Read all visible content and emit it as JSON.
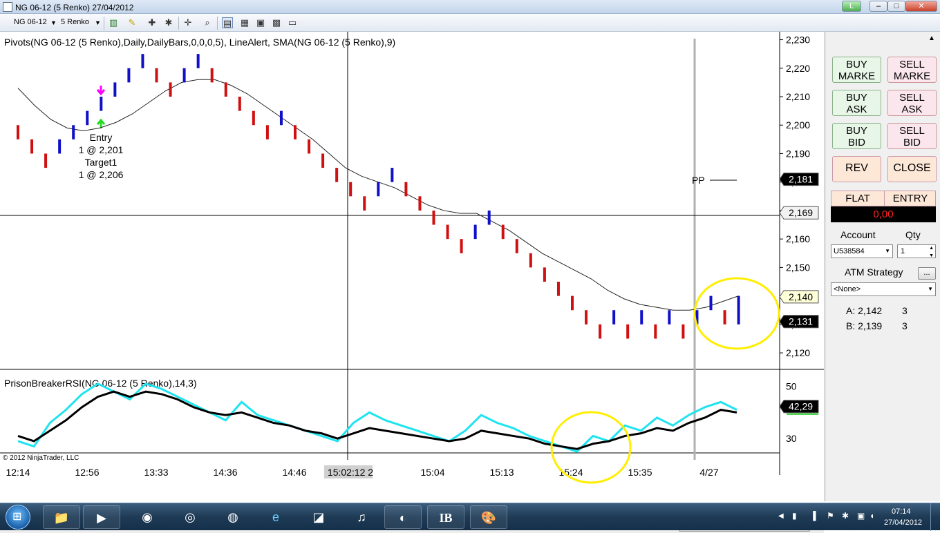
{
  "window": {
    "title": "NG 06-12 (5 Renko)  27/04/2012",
    "link_button": "L",
    "minimize_label": "–",
    "maximize_label": "□",
    "close_label": "✕"
  },
  "toolbar": {
    "instrument": "NG 06-12",
    "period": "5 Renko"
  },
  "chart": {
    "price_panel_title": "Pivots(NG 06-12 (5 Renko),Daily,DailyBars,0,0,0,5), LineAlert, SMA(NG 06-12 (5 Renko),9)",
    "indicator_title": "PrisonBreakerRSI(NG 06-12 (5 Renko),14,3)",
    "copyright": "© 2012 NinjaTrader, LLC",
    "pp_label": "PP",
    "annotation": {
      "line1": "Entry",
      "line2": "1 @ 2,201",
      "line3": "Target1",
      "line4": "1 @ 2,206"
    },
    "colors": {
      "up_brick": "#1010c8",
      "down_brick": "#d01010",
      "sma": "#222222",
      "rsi_fast": "#1ee4f0",
      "rsi_slow": "#000000",
      "highlight": "#ffee00"
    }
  },
  "chart_data": {
    "type": "bar",
    "title": "Pivots(NG 06-12 (5 Renko),Daily,DailyBars,0,0,0,5), LineAlert, SMA(NG 06-12 (5 Renko),9)",
    "price_ticks": [
      "2,230",
      "2,220",
      "2,210",
      "2,200",
      "2,190",
      "2,181",
      "2,169",
      "2,160",
      "2,150",
      "2,140",
      "2,131",
      "2,120"
    ],
    "price_tick_values": [
      2.23,
      2.22,
      2.21,
      2.2,
      2.19,
      2.18,
      2.17,
      2.16,
      2.15,
      2.14,
      2.13,
      2.12
    ],
    "price_range": [
      2.1142,
      2.2328
    ],
    "price_markers": [
      {
        "label": "2,181",
        "value": 2.181,
        "style": "dark"
      },
      {
        "label": "2,169",
        "value": 2.1692,
        "style": "light"
      },
      {
        "label": "2,140",
        "value": 2.1397,
        "style": "yellow"
      },
      {
        "label": "2,131",
        "value": 2.131,
        "style": "dark"
      }
    ],
    "rsi_ticks": [
      "50",
      "30"
    ],
    "rsi_tick_values": [
      50,
      30
    ],
    "rsi_range": [
      24.5,
      56.5
    ],
    "rsi_marker": {
      "label": "42,29",
      "value": 42.29
    },
    "time_labels": [
      "12:14",
      "12:56",
      "13:33",
      "14:36",
      "14:46",
      "15:02:12 2",
      "15:04",
      "15:13",
      "15:24",
      "15:35",
      "4/27"
    ],
    "bricks": [
      {
        "dir": "down",
        "open": 2.2,
        "close": 2.195
      },
      {
        "dir": "down",
        "open": 2.195,
        "close": 2.19
      },
      {
        "dir": "down",
        "open": 2.19,
        "close": 2.185
      },
      {
        "dir": "up",
        "open": 2.19,
        "close": 2.195
      },
      {
        "dir": "up",
        "open": 2.195,
        "close": 2.2
      },
      {
        "dir": "up",
        "open": 2.2,
        "close": 2.205
      },
      {
        "dir": "up",
        "open": 2.205,
        "close": 2.21
      },
      {
        "dir": "up",
        "open": 2.21,
        "close": 2.215
      },
      {
        "dir": "up",
        "open": 2.215,
        "close": 2.22
      },
      {
        "dir": "up",
        "open": 2.22,
        "close": 2.225
      },
      {
        "dir": "down",
        "open": 2.22,
        "close": 2.215
      },
      {
        "dir": "down",
        "open": 2.215,
        "close": 2.21
      },
      {
        "dir": "up",
        "open": 2.215,
        "close": 2.22
      },
      {
        "dir": "up",
        "open": 2.22,
        "close": 2.225
      },
      {
        "dir": "down",
        "open": 2.22,
        "close": 2.215
      },
      {
        "dir": "down",
        "open": 2.215,
        "close": 2.21
      },
      {
        "dir": "down",
        "open": 2.21,
        "close": 2.205
      },
      {
        "dir": "down",
        "open": 2.205,
        "close": 2.2
      },
      {
        "dir": "down",
        "open": 2.2,
        "close": 2.195
      },
      {
        "dir": "up",
        "open": 2.2,
        "close": 2.205
      },
      {
        "dir": "down",
        "open": 2.2,
        "close": 2.195
      },
      {
        "dir": "down",
        "open": 2.195,
        "close": 2.19
      },
      {
        "dir": "down",
        "open": 2.19,
        "close": 2.185
      },
      {
        "dir": "down",
        "open": 2.185,
        "close": 2.18
      },
      {
        "dir": "down",
        "open": 2.18,
        "close": 2.175
      },
      {
        "dir": "down",
        "open": 2.175,
        "close": 2.17
      },
      {
        "dir": "up",
        "open": 2.175,
        "close": 2.18
      },
      {
        "dir": "up",
        "open": 2.18,
        "close": 2.185
      },
      {
        "dir": "down",
        "open": 2.18,
        "close": 2.175
      },
      {
        "dir": "down",
        "open": 2.175,
        "close": 2.17
      },
      {
        "dir": "down",
        "open": 2.17,
        "close": 2.165
      },
      {
        "dir": "down",
        "open": 2.165,
        "close": 2.16
      },
      {
        "dir": "down",
        "open": 2.16,
        "close": 2.155
      },
      {
        "dir": "up",
        "open": 2.16,
        "close": 2.165
      },
      {
        "dir": "up",
        "open": 2.165,
        "close": 2.17
      },
      {
        "dir": "down",
        "open": 2.165,
        "close": 2.16
      },
      {
        "dir": "down",
        "open": 2.16,
        "close": 2.155
      },
      {
        "dir": "down",
        "open": 2.155,
        "close": 2.15
      },
      {
        "dir": "down",
        "open": 2.15,
        "close": 2.145
      },
      {
        "dir": "down",
        "open": 2.145,
        "close": 2.14
      },
      {
        "dir": "down",
        "open": 2.14,
        "close": 2.135
      },
      {
        "dir": "down",
        "open": 2.135,
        "close": 2.13
      },
      {
        "dir": "down",
        "open": 2.13,
        "close": 2.125
      },
      {
        "dir": "up",
        "open": 2.13,
        "close": 2.135
      },
      {
        "dir": "down",
        "open": 2.13,
        "close": 2.125
      },
      {
        "dir": "up",
        "open": 2.13,
        "close": 2.135
      },
      {
        "dir": "down",
        "open": 2.13,
        "close": 2.125
      },
      {
        "dir": "up",
        "open": 2.13,
        "close": 2.135
      },
      {
        "dir": "down",
        "open": 2.13,
        "close": 2.125
      },
      {
        "dir": "up",
        "open": 2.13,
        "close": 2.135
      },
      {
        "dir": "up",
        "open": 2.135,
        "close": 2.14
      },
      {
        "dir": "down",
        "open": 2.135,
        "close": 2.13
      },
      {
        "dir": "up",
        "open": 2.13,
        "close": 2.14
      }
    ],
    "sma": [
      2.213,
      2.207,
      2.202,
      2.199,
      2.198,
      2.199,
      2.201,
      2.204,
      2.208,
      2.212,
      2.215,
      2.216,
      2.216,
      2.214,
      2.211,
      2.207,
      2.203,
      2.199,
      2.195,
      2.19,
      2.185,
      2.182,
      2.18,
      2.178,
      2.175,
      2.172,
      2.17,
      2.169,
      2.169,
      2.166,
      2.163,
      2.159,
      2.155,
      2.152,
      2.149,
      2.146,
      2.142,
      2.139,
      2.137,
      2.136,
      2.135,
      2.135,
      2.136,
      2.138,
      2.14
    ],
    "rsi_fast": [
      29,
      27,
      36,
      41,
      47,
      51,
      48,
      45,
      51,
      49,
      46,
      43,
      40,
      37,
      44,
      39,
      37,
      35,
      33,
      31,
      29,
      36,
      40,
      37,
      35,
      33,
      31,
      29,
      33,
      39,
      36,
      34,
      31,
      29,
      27,
      25,
      31,
      29,
      35,
      33,
      38,
      35,
      39,
      42,
      44,
      41
    ],
    "rsi_slow": [
      31,
      29,
      33,
      37,
      42,
      46,
      48,
      46,
      48,
      47,
      45,
      42,
      40,
      39,
      40,
      38,
      36,
      35,
      33,
      32,
      30,
      32,
      34,
      33,
      32,
      31,
      30,
      29,
      30,
      33,
      32,
      31,
      30,
      28,
      27,
      26,
      28,
      29,
      31,
      32,
      34,
      33,
      36,
      38,
      41,
      40
    ]
  },
  "right_panel": {
    "buttons": [
      {
        "id": "buy-market",
        "l1": "BUY",
        "l2": "MARKE"
      },
      {
        "id": "sell-market",
        "l1": "SELL",
        "l2": "MARKE"
      },
      {
        "id": "buy-ask",
        "l1": "BUY",
        "l2": "ASK"
      },
      {
        "id": "sell-ask",
        "l1": "SELL",
        "l2": "ASK"
      },
      {
        "id": "buy-bid",
        "l1": "BUY",
        "l2": "BID"
      },
      {
        "id": "sell-bid",
        "l1": "SELL",
        "l2": "BID"
      }
    ],
    "rev_label": "REV",
    "close_label": "CLOSE",
    "position_label": "FLAT",
    "entry_label": "ENTRY",
    "pnl_value": "0,00",
    "account_label": "Account",
    "qty_label": "Qty",
    "account_value": "U538584",
    "qty_value": "1",
    "atm_label": "ATM Strategy",
    "atm_button": "...",
    "atm_value": "<None>",
    "ask_label": "A: 2,142",
    "ask_size": "3",
    "bid_label": "B: 2,139",
    "bid_size": "3"
  },
  "taskbar": {
    "clock_time": "07:14",
    "clock_date": "27/04/2012"
  }
}
